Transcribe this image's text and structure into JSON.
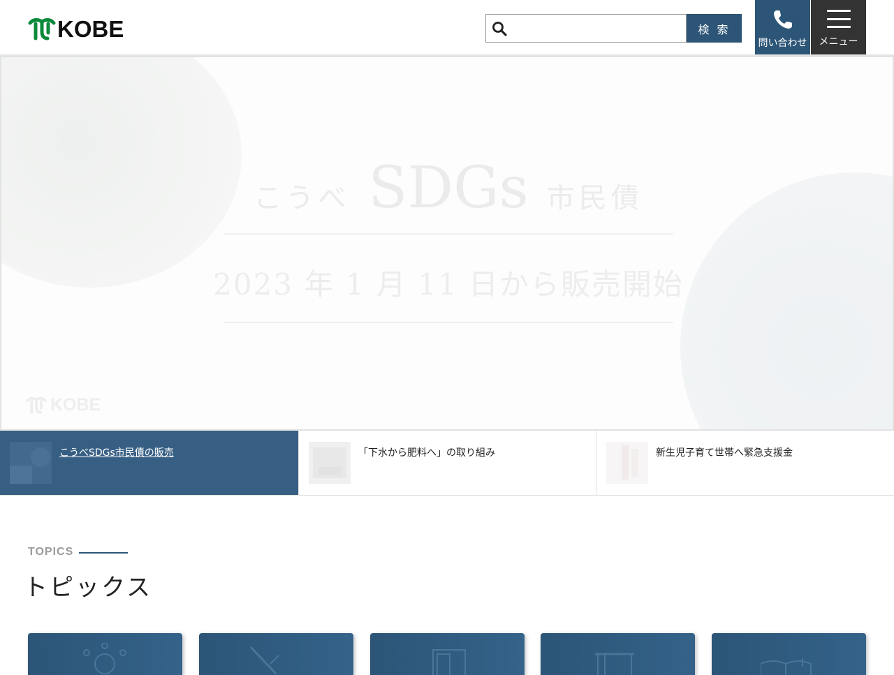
{
  "header": {
    "logo_text": "KOBE",
    "search": {
      "placeholder": "",
      "button_label": "検 索"
    },
    "contact_label": "問い合わせ",
    "menu_label": "メニュー",
    "icons": {
      "search": "search-icon",
      "contact": "phone-icon",
      "menu": "hamburger-icon"
    },
    "colors": {
      "accent": "#2c5577",
      "menu_bg": "#333333"
    }
  },
  "hero": {
    "title_prefix": "こうべ",
    "title_main": "SDGs",
    "title_suffix": "市民債",
    "date_text": "2023 年 1 月 11 日から販売開始",
    "logo_text": "KOBE"
  },
  "features": [
    {
      "label": "こうべSDGs市民債の販売",
      "active": true
    },
    {
      "label": "「下水から肥料へ」の取り組み",
      "active": false
    },
    {
      "label": "新生児子育て世帯へ緊急支援金",
      "active": false
    }
  ],
  "topics": {
    "eyebrow": "TOPICS",
    "title": "トピックス",
    "cards": [
      "network-icon",
      "pen-icon",
      "document-icon",
      "building-icon",
      "book-icon"
    ]
  }
}
